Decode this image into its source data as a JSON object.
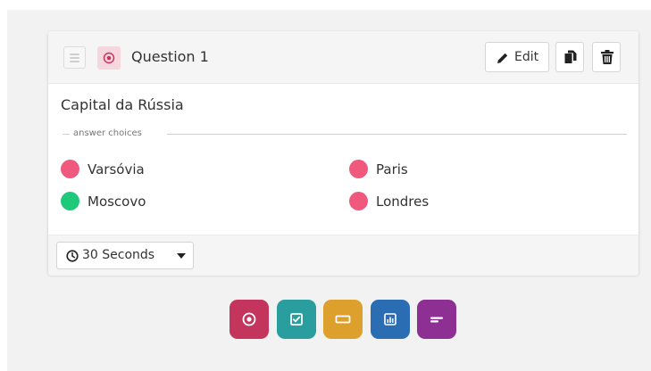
{
  "question": {
    "title": "Question 1",
    "text": "Capital da Rússia",
    "type_icon": "radio-icon",
    "actions": {
      "edit_label": "Edit",
      "copy_icon": "copy-icon",
      "delete_icon": "trash-icon"
    },
    "choices_legend": "answer choices",
    "choices": [
      {
        "label": "Varsóvia",
        "correct": false
      },
      {
        "label": "Paris",
        "correct": false
      },
      {
        "label": "Moscovo",
        "correct": true
      },
      {
        "label": "Londres",
        "correct": false
      }
    ],
    "timer": {
      "value": "30 Seconds",
      "icon": "clock-icon"
    }
  },
  "colors": {
    "wrong": "#f0587e",
    "correct": "#1fc97a",
    "badge_bg": "#f6d7df",
    "badge_fg": "#c9365d"
  },
  "question_types": [
    {
      "name": "single-choice",
      "icon": "radio-icon",
      "color": "#c4355e"
    },
    {
      "name": "multiple-choice",
      "icon": "checkbox-icon",
      "color": "#2a9d9e"
    },
    {
      "name": "text-answer",
      "icon": "input-box-icon",
      "color": "#dea02c"
    },
    {
      "name": "poll",
      "icon": "bar-chart-icon",
      "color": "#2b6db2"
    },
    {
      "name": "open-ended",
      "icon": "text-lines-icon",
      "color": "#8e2f93"
    }
  ]
}
